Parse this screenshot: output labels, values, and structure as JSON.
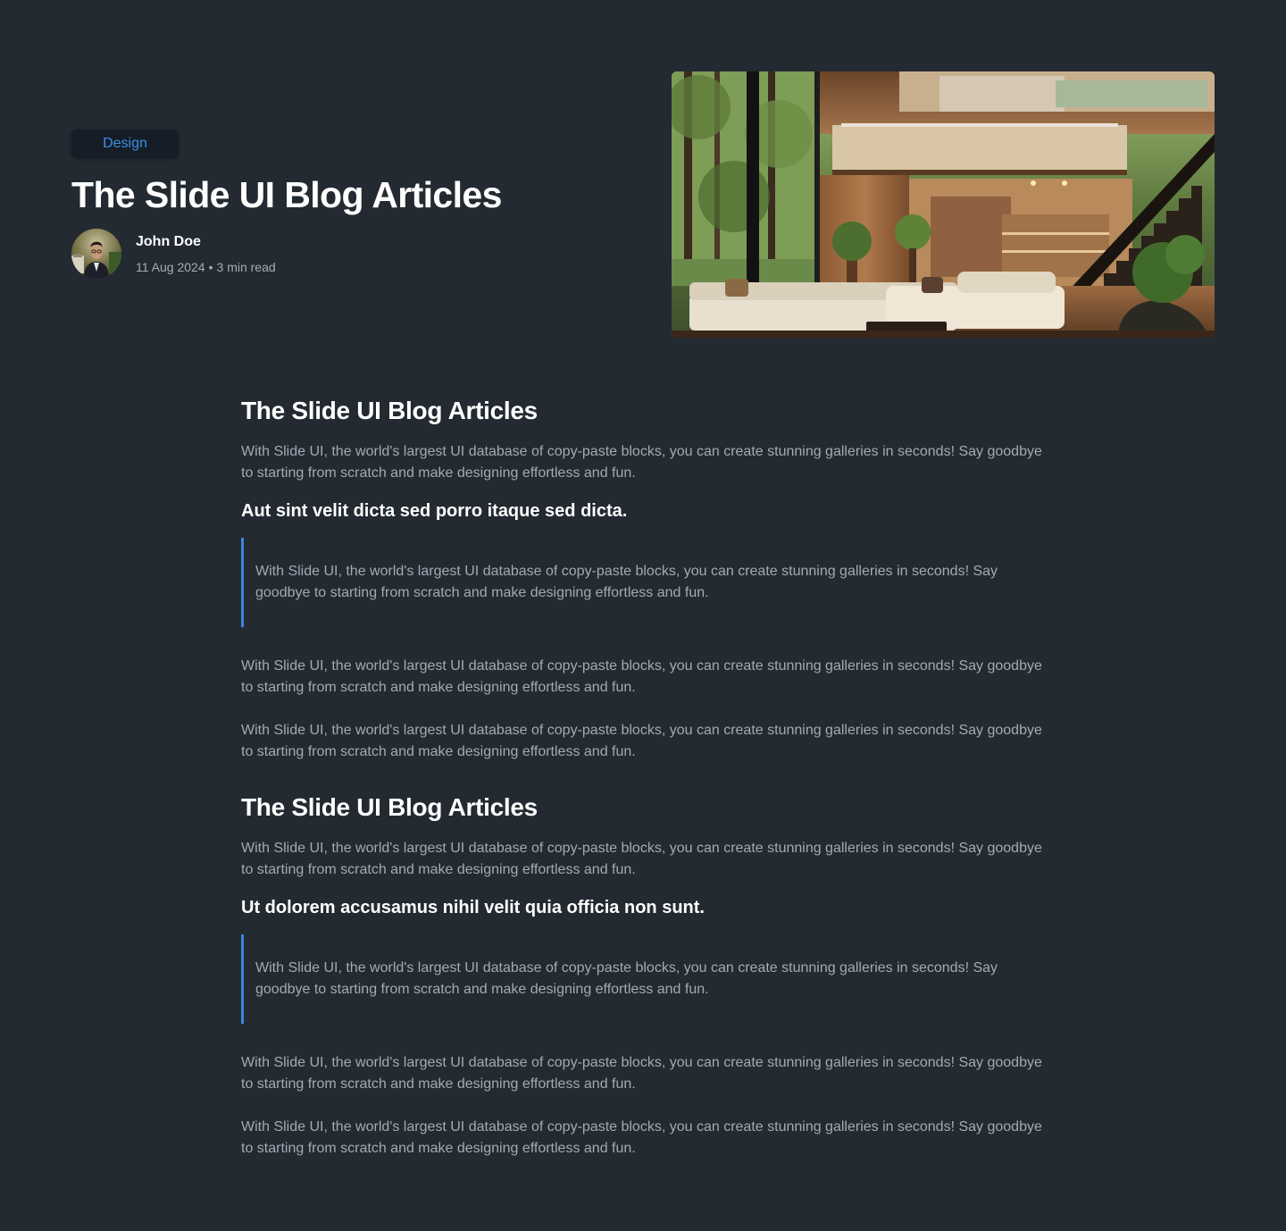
{
  "hero": {
    "category": "Design",
    "title": "The Slide UI Blog Articles",
    "author": {
      "name": "John Doe",
      "date": "11 Aug 2024",
      "separator": "•",
      "read_time": "3 min read"
    }
  },
  "article": {
    "sections": [
      {
        "heading": "The Slide UI Blog Articles",
        "intro": "With Slide UI, the world's largest UI database of copy-paste blocks, you can create stunning galleries in seconds! Say goodbye to starting from scratch and make designing effortless and fun.",
        "subheading": "Aut sint velit dicta sed porro itaque sed dicta.",
        "quote": "With Slide UI, the world's largest UI database of copy-paste blocks, you can create stunning galleries in seconds! Say goodbye to starting from scratch and make designing effortless and fun.",
        "paragraphs": [
          "With Slide UI, the world's largest UI database of copy-paste blocks, you can create stunning galleries in seconds! Say goodbye to starting from scratch and make designing effortless and fun.",
          "With Slide UI, the world's largest UI database of copy-paste blocks, you can create stunning galleries in seconds! Say goodbye to starting from scratch and make designing effortless and fun."
        ]
      },
      {
        "heading": "The Slide UI Blog Articles",
        "intro": "With Slide UI, the world's largest UI database of copy-paste blocks, you can create stunning galleries in seconds! Say goodbye to starting from scratch and make designing effortless and fun.",
        "subheading": "Ut dolorem accusamus nihil velit quia officia non sunt.",
        "quote": "With Slide UI, the world's largest UI database of copy-paste blocks, you can create stunning galleries in seconds! Say goodbye to starting from scratch and make designing effortless and fun.",
        "paragraphs": [
          "With Slide UI, the world's largest UI database of copy-paste blocks, you can create stunning galleries in seconds! Say goodbye to starting from scratch and make designing effortless and fun.",
          "With Slide UI, the world's largest UI database of copy-paste blocks, you can create stunning galleries in seconds! Say goodbye to starting from scratch and make designing effortless and fun."
        ]
      }
    ]
  },
  "colors": {
    "background": "#232a31",
    "accent": "#3b8fe5",
    "body_text": "#a3aab3",
    "heading_text": "#ffffff"
  },
  "images": {
    "avatar": "avatar-photo",
    "hero": "modern-interior-photo"
  }
}
